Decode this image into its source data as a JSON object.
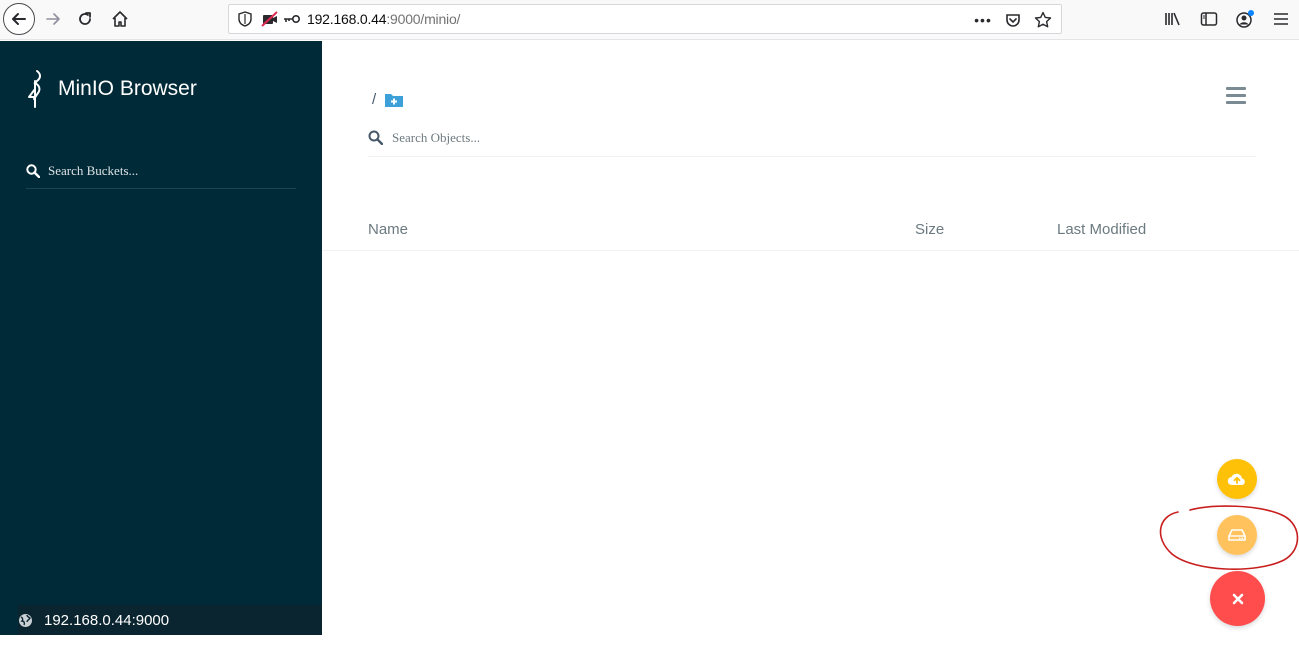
{
  "browser": {
    "url_host": "192.168.0.44",
    "url_rest": ":9000/minio/",
    "page_actions_label": "•••"
  },
  "sidebar": {
    "brand": "MinIO Browser",
    "search_placeholder": "Search Buckets...",
    "host": "192.168.0.44:9000"
  },
  "main": {
    "breadcrumb_root": "/",
    "search_placeholder": "Search Objects...",
    "columns": {
      "name": "Name",
      "size": "Size",
      "modified": "Last Modified"
    }
  },
  "colors": {
    "sidebar_bg": "#002a37",
    "fab_upload": "#ffc107",
    "fab_bucket": "#ffc25c",
    "fab_close": "#ff4d4d",
    "folder_icon": "#3ea0d8",
    "annotation": "#c81e1e"
  },
  "icons": {
    "back": "back-arrow-icon",
    "forward": "forward-arrow-icon",
    "reload": "reload-icon",
    "home": "home-icon",
    "shield": "shield-icon",
    "camera_blocked": "camera-blocked-icon",
    "key": "key-icon",
    "pocket": "pocket-icon",
    "bookmark": "star-icon",
    "library": "library-icon",
    "sidebar_toggle": "sidebar-toggle-icon",
    "account": "account-icon",
    "menu": "hamburger-menu-icon",
    "globe": "globe-icon",
    "upload": "cloud-upload-icon",
    "bucket": "hard-drive-icon",
    "close": "close-icon"
  }
}
